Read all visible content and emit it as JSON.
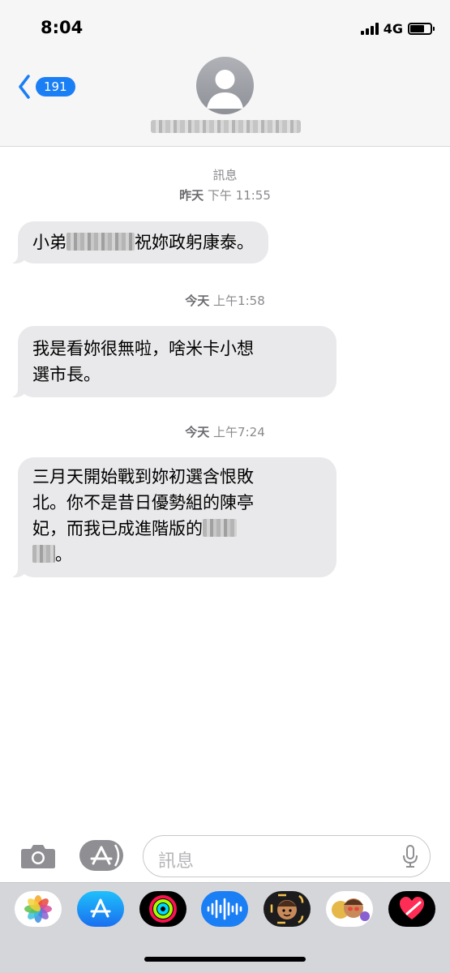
{
  "status_bar": {
    "time": "8:04",
    "network": "4G",
    "battery_level": 0.75
  },
  "header": {
    "back_count": "191"
  },
  "conversation": {
    "label": "訊息",
    "messages": [
      {
        "timestamp_day": "昨天",
        "timestamp_time": "下午 11:55",
        "text_before": "小弟",
        "text_after": "祝妳政躬康泰。"
      },
      {
        "timestamp_day": "今天",
        "timestamp_time": "上午1:58",
        "line1": "我是看妳很無啦，啥米卡小想",
        "line2": "選市長。"
      },
      {
        "timestamp_day": "今天",
        "timestamp_time": "上午7:24",
        "line1": "三月天開始戰到妳初選含恨敗",
        "line2": "北。你不是昔日優勢組的陳亭",
        "line3": "妃，而我已成進階版的",
        "line4_after": "。"
      }
    ]
  },
  "compose": {
    "placeholder": "訊息"
  },
  "colors": {
    "accent": "#1a7ef5",
    "bubble": "#e9e9eb",
    "timestamp": "#8a8a8e"
  },
  "app_drawer": [
    "photos-icon",
    "app-store-icon",
    "activity-icon",
    "audio-message-icon",
    "memoji-icon",
    "memoji-stickers-icon",
    "digital-touch-icon"
  ]
}
